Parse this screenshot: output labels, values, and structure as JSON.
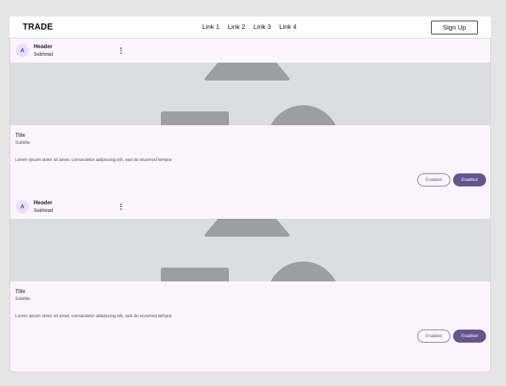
{
  "navbar": {
    "brand": "TRADE",
    "links": [
      "Link 1",
      "Link 2",
      "Link 3",
      "Link 4"
    ],
    "signup_label": "Sign Up"
  },
  "cards": [
    {
      "avatar_letter": "A",
      "header": "Header",
      "subhead": "Subhead",
      "more_icon": "more-vert-icon",
      "title": "Title",
      "subtitle": "Subtitle",
      "body": "Lorem ipsum dolor sit amet, consectetur adipiscing elit, sed do eiusmod tempor",
      "outline_button": "Enabled",
      "filled_button": "Enabled"
    },
    {
      "avatar_letter": "A",
      "header": "Header",
      "subhead": "Subhead",
      "more_icon": "more-vert-icon",
      "title": "Title",
      "subtitle": "Subtitle",
      "body": "Lorem ipsum dolor sit amet, consectetur adipiscing elit, sed do eiusmod tempor",
      "outline_button": "Enabled",
      "filled_button": "Enabled"
    }
  ],
  "colors": {
    "page_background": "#e5e5e5",
    "surface": "#fcf5fd",
    "primary": "#65558f",
    "avatar_bg": "#eaddff",
    "media_bg": "#dcdde0",
    "media_shapes": "#9c9ea2"
  }
}
